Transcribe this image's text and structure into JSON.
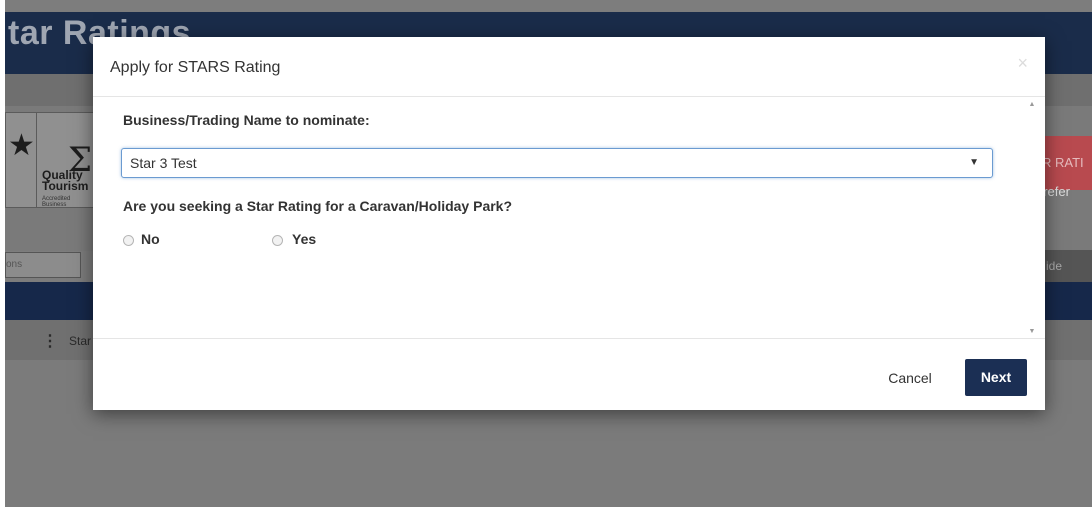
{
  "background": {
    "page_title": "tar Ratings",
    "badge_text": "Quality\nTourism",
    "badge_small_text": "Accredited\nBusiness",
    "left_button_label": "ons",
    "breadcrumb_text": "Star",
    "right_red_label": "R RATI",
    "right_refer_text": "/ refer",
    "right_button_label": "ide"
  },
  "modal": {
    "title": "Apply for STARS Rating",
    "close_icon": "×",
    "business_label": "Business/Trading Name to nominate:",
    "business_select_value": "Star 3 Test",
    "caravan_question": "Are you seeking a Star Rating for a Caravan/Holiday Park?",
    "radio_options": [
      {
        "label": "No",
        "checked": false
      },
      {
        "label": "Yes",
        "checked": false
      }
    ],
    "cancel_label": "Cancel",
    "next_label": "Next"
  },
  "colors": {
    "primary": "#1b2f54",
    "overlay": "#7d7d7d",
    "focus_border": "#6b9bd1"
  }
}
